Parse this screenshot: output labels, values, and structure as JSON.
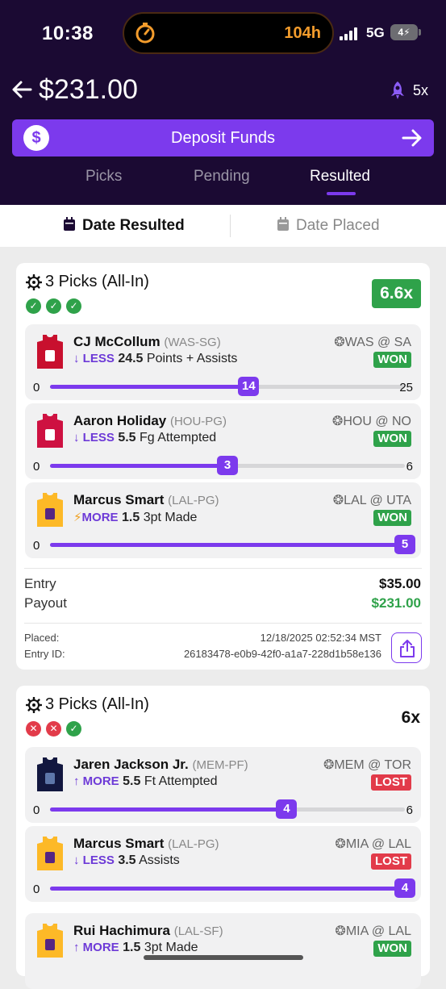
{
  "status_bar": {
    "time": "10:38",
    "timer": "104h",
    "network": "5G",
    "battery": "4"
  },
  "header": {
    "balance": "$231.00",
    "boost": "5x",
    "deposit_label": "Deposit Funds"
  },
  "tabs": [
    {
      "label": "Picks",
      "active": false
    },
    {
      "label": "Pending",
      "active": false
    },
    {
      "label": "Resulted",
      "active": true
    }
  ],
  "subtabs": {
    "resulted": "Date Resulted",
    "placed": "Date Placed"
  },
  "entries": [
    {
      "title": "3 Picks (All-In)",
      "multiplier": "6.6x",
      "outcomes": [
        "win",
        "win",
        "win"
      ],
      "picks": [
        {
          "player": "CJ McCollum",
          "pos": "(WAS-SG)",
          "dir": "LESS",
          "line": "24.5",
          "stat": "Points + Assists",
          "game": "WAS @ SA",
          "result": "WON",
          "min": "0",
          "max": "25",
          "actual": "14",
          "fraction": 0.56,
          "jersey": "#c8102e"
        },
        {
          "player": "Aaron Holiday",
          "pos": "(HOU-PG)",
          "dir": "LESS",
          "line": "5.5",
          "stat": "Fg Attempted",
          "game": "HOU @ NO",
          "result": "WON",
          "min": "0",
          "max": "6",
          "actual": "3",
          "fraction": 0.5,
          "jersey": "#ce1141"
        },
        {
          "player": "Marcus Smart",
          "pos": "(LAL-PG)",
          "dir": "MORE",
          "line": "1.5",
          "stat": "3pt Made",
          "game": "LAL @ UTA",
          "result": "WON",
          "min": "0",
          "max": "",
          "actual": "5",
          "fraction": 1.0,
          "jersey": "#fdb927"
        }
      ],
      "entry_label": "Entry",
      "entry_value": "$35.00",
      "payout_label": "Payout",
      "payout_value": "$231.00",
      "placed_label": "Placed:",
      "placed_value": "12/18/2025 02:52:34 MST",
      "id_label": "Entry ID:",
      "id_value": "26183478-e0b9-42f0-a1a7-228d1b58e136"
    },
    {
      "title": "3 Picks (All-In)",
      "multiplier": "6x",
      "outcomes": [
        "loss",
        "loss",
        "win"
      ],
      "picks": [
        {
          "player": "Jaren Jackson Jr.",
          "pos": "(MEM-PF)",
          "dir": "MORE",
          "line": "5.5",
          "stat": "Ft Attempted",
          "game": "MEM @ TOR",
          "result": "LOST",
          "min": "0",
          "max": "6",
          "actual": "4",
          "fraction": 0.667,
          "jersey": "#12173f"
        },
        {
          "player": "Marcus Smart",
          "pos": "(LAL-PG)",
          "dir": "LESS",
          "line": "3.5",
          "stat": "Assists",
          "game": "MIA @ LAL",
          "result": "LOST",
          "min": "0",
          "max": "",
          "actual": "4",
          "fraction": 1.0,
          "jersey": "#fdb927"
        },
        {
          "player": "Rui Hachimura",
          "pos": "(LAL-SF)",
          "dir": "MORE",
          "line": "1.5",
          "stat": "3pt Made",
          "game": "MIA @ LAL",
          "result": "WON",
          "min": "",
          "max": "",
          "actual": "",
          "fraction": 0,
          "jersey": "#fdb927"
        }
      ]
    }
  ]
}
